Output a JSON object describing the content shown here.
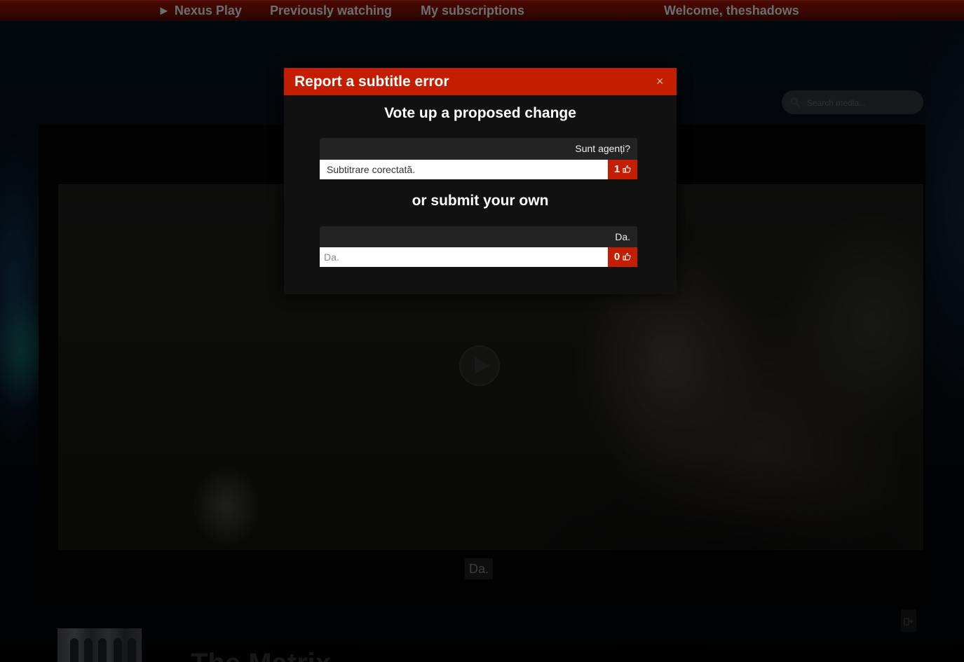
{
  "nav": {
    "logo_arrow": "►",
    "logo_label": "Nexus Play",
    "previously_watching": "Previously watching",
    "subscriptions": "My subscriptions",
    "welcome": "Welcome, theshadows"
  },
  "search": {
    "placeholder": "Search media..."
  },
  "player": {
    "subtitle_caption": "Da."
  },
  "movie": {
    "title": "The Matrix"
  },
  "modal": {
    "title": "Report a subtitle error",
    "close_glyph": "×",
    "vote_heading": "Vote up a proposed change",
    "submit_heading": "or submit your own",
    "existing": {
      "original": "Sunt agenți?",
      "proposal": "Subtitrare corectată.",
      "votes": "1"
    },
    "own": {
      "original": "Da.",
      "placeholder": "Da.",
      "votes": "0"
    }
  },
  "colors": {
    "accent": "#c41d00",
    "nav_bg": "#2a0500",
    "modal_bg": "#111111"
  },
  "icons": {
    "vote": "thumbs-up-icon",
    "search": "search-icon",
    "play": "play-icon",
    "close": "close-icon"
  }
}
